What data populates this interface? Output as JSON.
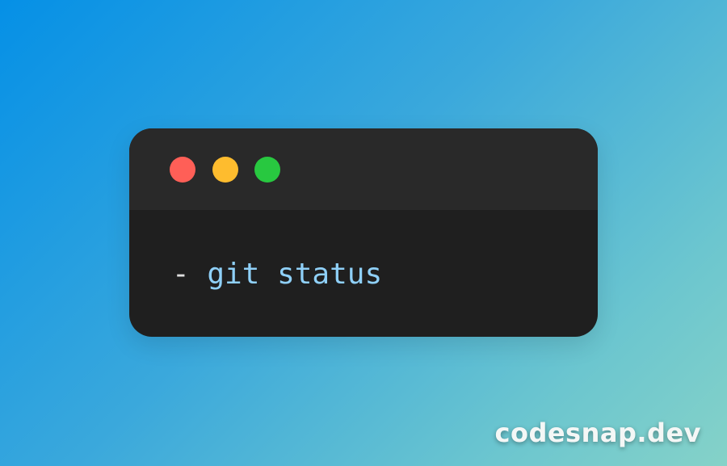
{
  "window": {
    "buttons": [
      {
        "name": "close",
        "color": "#ff5f57"
      },
      {
        "name": "minimize",
        "color": "#febc2e"
      },
      {
        "name": "maximize",
        "color": "#28c840"
      }
    ],
    "code": {
      "prefix": "-",
      "command": "git status",
      "prefix_color": "#e0e0e0",
      "command_color": "#8fd0f8"
    },
    "background_color": "#1f1f1f",
    "titlebar_color": "#292929"
  },
  "watermark": {
    "text": "codesnap.dev"
  }
}
